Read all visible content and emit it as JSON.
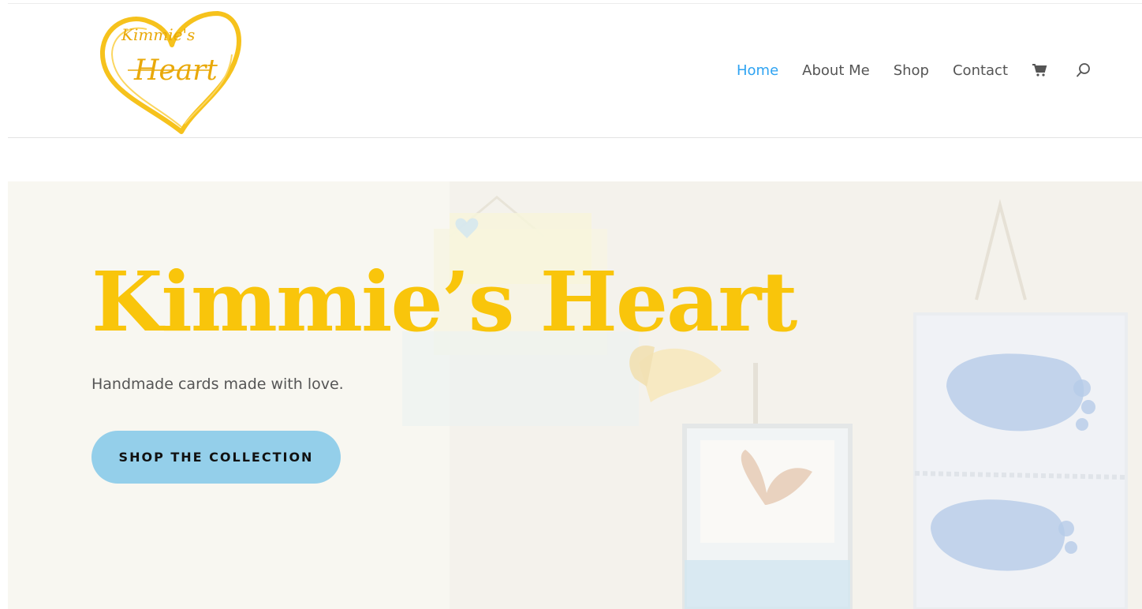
{
  "brand": {
    "logo_script_top": "Kimmie's",
    "logo_script_main": "Heart",
    "logo_color": "#f6c21c"
  },
  "nav": {
    "items": [
      {
        "label": "Home",
        "active": true
      },
      {
        "label": "About Me",
        "active": false
      },
      {
        "label": "Shop",
        "active": false
      },
      {
        "label": "Contact",
        "active": false
      }
    ],
    "cart_icon": "shopping-cart-icon",
    "search_icon": "search-icon",
    "active_color": "#2ea3f2"
  },
  "hero": {
    "title": "Kimmie’s Heart",
    "subtitle": "Handmade cards made with love.",
    "cta_label": "SHOP THE COLLECTION",
    "title_color": "#f9c50b",
    "cta_color": "#94cfea"
  }
}
